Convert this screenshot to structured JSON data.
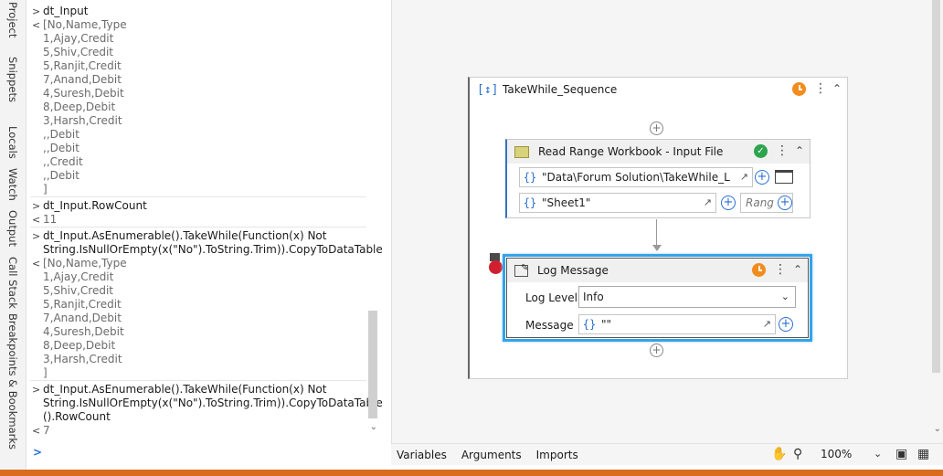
{
  "side_tabs": [
    "Project",
    "Snippets",
    "Locals",
    "Watch",
    "Output",
    "Call Stack",
    "Breakpoints & Bookmarks"
  ],
  "immediate": {
    "entries": [
      {
        "expression": "dt_Input",
        "result": "[No,Name,Type\n1,Ajay,Credit\n5,Shiv,Credit\n5,Ranjit,Credit\n7,Anand,Debit\n4,Suresh,Debit\n8,Deep,Debit\n3,Harsh,Credit\n,,Debit\n,,Debit\n,,Credit\n,,Debit\n]"
      },
      {
        "expression": "dt_Input.RowCount",
        "result": "11"
      },
      {
        "expression": "dt_Input.AsEnumerable().TakeWhile(Function(x) Not String.IsNullOrEmpty(x(\"No\").ToString.Trim)).CopyToDataTable",
        "result": "[No,Name,Type\n1,Ajay,Credit\n5,Shiv,Credit\n5,Ranjit,Credit\n7,Anand,Debit\n4,Suresh,Debit\n8,Deep,Debit\n3,Harsh,Credit\n]"
      },
      {
        "expression": "dt_Input.AsEnumerable().TakeWhile(Function(x) Not String.IsNullOrEmpty(x(\"No\").ToString.Trim)).CopyToDataTable ().RowCount",
        "result": "7"
      }
    ],
    "prompt": ">"
  },
  "designer": {
    "sequence_title": "TakeWhile_Sequence",
    "read_range": {
      "title": "Read Range Workbook - Input File",
      "path_value": "\"Data\\Forum Solution\\TakeWhile_LinC",
      "sheet_value": "\"Sheet1\"",
      "range_placeholder": "Rang"
    },
    "log_message": {
      "title": "Log Message",
      "level_label": "Log Level",
      "level_value": "Info",
      "message_label": "Message",
      "message_value": "\"\""
    }
  },
  "bottombar": {
    "tabs": [
      "Variables",
      "Arguments",
      "Imports"
    ],
    "zoom": "100%"
  },
  "colors": {
    "accent_orange": "#f28c1d",
    "status_strip": "#d96c1e",
    "selection_blue": "#35a3e8",
    "breakpoint_red": "#d0202f"
  }
}
